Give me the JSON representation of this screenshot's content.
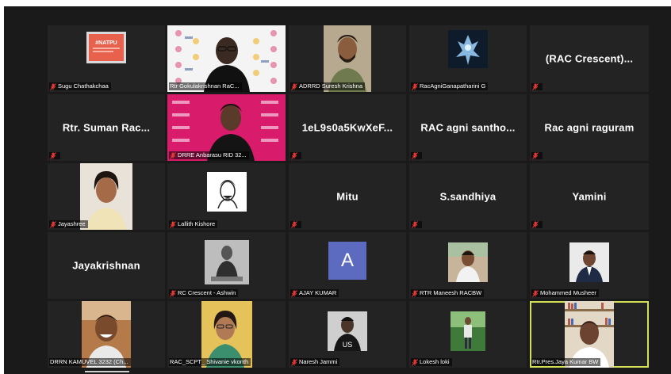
{
  "meeting": {
    "active_speaker": "Rtr.Pres.Jaya Kumar BW",
    "colors": {
      "stage": "#1a1a1a",
      "tile": "#232323",
      "active_border": "#d4e157",
      "mute_icon": "#e53935",
      "avatar_bg": "#5c6bc0"
    }
  },
  "participants": [
    {
      "name": "Sugu Chathakchaa",
      "type": "photo",
      "image": "natpu-poster",
      "poster_text": "#NATPU",
      "muted": true
    },
    {
      "name": "Rtr Gokulakrishnan RaC...",
      "type": "photo",
      "image": "man-with-glasses-rotary-backdrop",
      "muted": false
    },
    {
      "name": "ADRRD Suresh Krishna",
      "type": "photo",
      "image": "bearded-man",
      "muted": true
    },
    {
      "name": "RacAgniGanapatharini G",
      "type": "photo",
      "image": "glowing-figure",
      "muted": true
    },
    {
      "name": "",
      "display_name": "(RAC Crescent)...",
      "type": "name-only",
      "muted": true
    },
    {
      "name": "",
      "display_name": "Rtr. Suman Rac...",
      "type": "name-only",
      "muted": true
    },
    {
      "name": "DRRE Anbarasu RID 32...",
      "type": "photo",
      "image": "man-pink-backdrop",
      "muted": true
    },
    {
      "name": "",
      "display_name": "1eL9s0a5KwXeF...",
      "type": "name-only",
      "muted": true
    },
    {
      "name": "",
      "display_name": "RAC agni santho...",
      "type": "name-only",
      "muted": true
    },
    {
      "name": "",
      "display_name": "Rac agni raguram",
      "type": "name-only",
      "muted": true
    },
    {
      "name": "Jayashree",
      "type": "photo",
      "image": "woman-smiling",
      "muted": true
    },
    {
      "name": "Lallith Kishore",
      "type": "photo",
      "image": "sketch-portrait",
      "muted": true
    },
    {
      "name": "",
      "display_name": "Mitu",
      "type": "name-only",
      "muted": true
    },
    {
      "name": "",
      "display_name": "S.sandhiya",
      "type": "name-only",
      "muted": true
    },
    {
      "name": "",
      "display_name": "Yamini",
      "type": "name-only",
      "muted": true
    },
    {
      "name": "",
      "display_name": "Jayakrishnan",
      "type": "name-only",
      "muted": false
    },
    {
      "name": "RC Crescent - Ashwin",
      "type": "photo",
      "image": "bw-man-sitting",
      "muted": true
    },
    {
      "name": "AJAY KUMAR",
      "type": "avatar",
      "initial": "A",
      "muted": true
    },
    {
      "name": "RTR Maneesh RACBW",
      "type": "photo",
      "image": "man-outdoors",
      "muted": true
    },
    {
      "name": "Mohammed Musheer",
      "type": "photo",
      "image": "man-in-suit",
      "muted": true
    },
    {
      "name": "DRRN KAMUVEL 3232 (Ch...",
      "type": "photo",
      "image": "man-laughing",
      "muted": false
    },
    {
      "name": "RAC_SCPT_ Shivanie vkonth",
      "type": "photo",
      "image": "woman-yellow-wall",
      "muted": false
    },
    {
      "name": "Naresh Jammi",
      "type": "photo",
      "image": "man-us-shirt",
      "muted": true
    },
    {
      "name": "Lokesh loki",
      "type": "photo",
      "image": "man-standing-garden",
      "muted": true
    },
    {
      "name": "Rtr.Pres.Jaya Kumar BW",
      "type": "photo",
      "image": "man-bookshelf",
      "muted": false,
      "active": true
    }
  ]
}
